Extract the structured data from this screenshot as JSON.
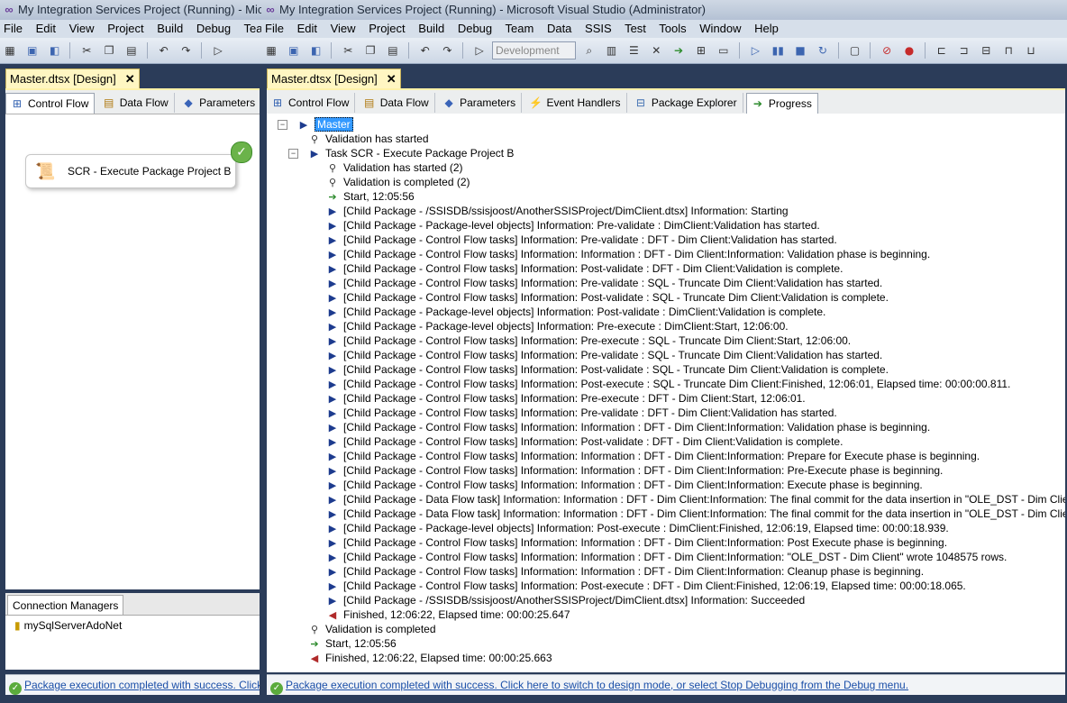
{
  "app": {
    "title_left": "My Integration Services Project (Running) - Microso",
    "title_right": "My Integration Services Project (Running) - Microsoft Visual Studio (Administrator)",
    "menu_left": [
      "File",
      "Edit",
      "View",
      "Project",
      "Build",
      "Debug",
      "Team"
    ],
    "menu_right": [
      "File",
      "Edit",
      "View",
      "Project",
      "Build",
      "Debug",
      "Team",
      "Data",
      "SSIS",
      "Test",
      "Tools",
      "Window",
      "Help"
    ],
    "config_combo": "Development"
  },
  "document": {
    "tab_title": "Master.dtsx [Design]",
    "close_glyph": "✕"
  },
  "designer_tabs_left": [
    "Control Flow",
    "Data Flow",
    "Parameters"
  ],
  "designer_tabs_right": [
    "Control Flow",
    "Data Flow",
    "Parameters",
    "Event Handlers",
    "Package Explorer",
    "Progress"
  ],
  "control_flow": {
    "task_label": "SCR - Execute Package Project B"
  },
  "connection_managers": {
    "tab_label": "Connection Managers",
    "items": [
      "mySqlServerAdoNet"
    ]
  },
  "status": {
    "left_text": "Package execution completed with success. Click here",
    "right_text": "Package execution completed with success. Click here to switch to design mode, or select Stop Debugging from the Debug menu."
  },
  "progress": {
    "rows": [
      {
        "indent": 0,
        "expander": "−",
        "icon": "play",
        "text": "Master",
        "selected": true
      },
      {
        "indent": 1,
        "icon": "valid",
        "text": "Validation has started"
      },
      {
        "indent": 1,
        "expander": "−",
        "icon": "play",
        "text": "Task SCR - Execute Package Project B"
      },
      {
        "indent": 2,
        "icon": "valid",
        "text": "Validation has started (2)"
      },
      {
        "indent": 2,
        "icon": "valid",
        "text": "Validation is completed (2)"
      },
      {
        "indent": 2,
        "icon": "start",
        "text": "Start, 12:05:56"
      },
      {
        "indent": 2,
        "icon": "play",
        "text": "[Child Package - /SSISDB/ssisjoost/AnotherSSISProject/DimClient.dtsx] Information: Starting"
      },
      {
        "indent": 2,
        "icon": "play",
        "text": "[Child Package - Package-level objects] Information: Pre-validate : DimClient:Validation has started."
      },
      {
        "indent": 2,
        "icon": "play",
        "text": "[Child Package - Control Flow tasks] Information: Pre-validate : DFT - Dim Client:Validation has started."
      },
      {
        "indent": 2,
        "icon": "play",
        "text": "[Child Package - Control Flow tasks] Information: Information : DFT - Dim Client:Information: Validation phase is beginning."
      },
      {
        "indent": 2,
        "icon": "play",
        "text": "[Child Package - Control Flow tasks] Information: Post-validate : DFT - Dim Client:Validation is complete."
      },
      {
        "indent": 2,
        "icon": "play",
        "text": "[Child Package - Control Flow tasks] Information: Pre-validate : SQL - Truncate Dim Client:Validation has started."
      },
      {
        "indent": 2,
        "icon": "play",
        "text": "[Child Package - Control Flow tasks] Information: Post-validate : SQL - Truncate Dim Client:Validation is complete."
      },
      {
        "indent": 2,
        "icon": "play",
        "text": "[Child Package - Package-level objects] Information: Post-validate : DimClient:Validation is complete."
      },
      {
        "indent": 2,
        "icon": "play",
        "text": "[Child Package - Package-level objects] Information: Pre-execute : DimClient:Start, 12:06:00."
      },
      {
        "indent": 2,
        "icon": "play",
        "text": "[Child Package - Control Flow tasks] Information: Pre-execute : SQL - Truncate Dim Client:Start, 12:06:00."
      },
      {
        "indent": 2,
        "icon": "play",
        "text": "[Child Package - Control Flow tasks] Information: Pre-validate : SQL - Truncate Dim Client:Validation has started."
      },
      {
        "indent": 2,
        "icon": "play",
        "text": "[Child Package - Control Flow tasks] Information: Post-validate : SQL - Truncate Dim Client:Validation is complete."
      },
      {
        "indent": 2,
        "icon": "play",
        "text": "[Child Package - Control Flow tasks] Information: Post-execute : SQL - Truncate Dim Client:Finished, 12:06:01, Elapsed time: 00:00:00.811."
      },
      {
        "indent": 2,
        "icon": "play",
        "text": "[Child Package - Control Flow tasks] Information: Pre-execute : DFT - Dim Client:Start, 12:06:01."
      },
      {
        "indent": 2,
        "icon": "play",
        "text": "[Child Package - Control Flow tasks] Information: Pre-validate : DFT - Dim Client:Validation has started."
      },
      {
        "indent": 2,
        "icon": "play",
        "text": "[Child Package - Control Flow tasks] Information: Information : DFT - Dim Client:Information: Validation phase is beginning."
      },
      {
        "indent": 2,
        "icon": "play",
        "text": "[Child Package - Control Flow tasks] Information: Post-validate : DFT - Dim Client:Validation is complete."
      },
      {
        "indent": 2,
        "icon": "play",
        "text": "[Child Package - Control Flow tasks] Information: Information : DFT - Dim Client:Information: Prepare for Execute phase is beginning."
      },
      {
        "indent": 2,
        "icon": "play",
        "text": "[Child Package - Control Flow tasks] Information: Information : DFT - Dim Client:Information: Pre-Execute phase is beginning."
      },
      {
        "indent": 2,
        "icon": "play",
        "text": "[Child Package - Control Flow tasks] Information: Information : DFT - Dim Client:Information: Execute phase is beginning."
      },
      {
        "indent": 2,
        "icon": "play",
        "text": "[Child Package - Data Flow task] Information: Information : DFT - Dim Client:Information: The final commit for the data insertion in \"OLE_DST - Dim Client\" has started."
      },
      {
        "indent": 2,
        "icon": "play",
        "text": "[Child Package - Data Flow task] Information: Information : DFT - Dim Client:Information: The final commit for the data insertion  in \"OLE_DST - Dim Client\" has ended."
      },
      {
        "indent": 2,
        "icon": "play",
        "text": "[Child Package - Package-level objects] Information: Post-execute : DimClient:Finished, 12:06:19, Elapsed time: 00:00:18.939."
      },
      {
        "indent": 2,
        "icon": "play",
        "text": "[Child Package - Control Flow tasks] Information: Information : DFT - Dim Client:Information: Post Execute phase is beginning."
      },
      {
        "indent": 2,
        "icon": "play",
        "text": "[Child Package - Control Flow tasks] Information: Information : DFT - Dim Client:Information: \"OLE_DST - Dim Client\" wrote 1048575 rows."
      },
      {
        "indent": 2,
        "icon": "play",
        "text": "[Child Package - Control Flow tasks] Information: Information : DFT - Dim Client:Information: Cleanup phase is beginning."
      },
      {
        "indent": 2,
        "icon": "play",
        "text": "[Child Package - Control Flow tasks] Information: Post-execute : DFT - Dim Client:Finished, 12:06:19, Elapsed time: 00:00:18.065."
      },
      {
        "indent": 2,
        "icon": "play",
        "text": "[Child Package - /SSISDB/ssisjoost/AnotherSSISProject/DimClient.dtsx] Information: Succeeded"
      },
      {
        "indent": 2,
        "icon": "fin",
        "text": "Finished, 12:06:22, Elapsed time: 00:00:25.647"
      },
      {
        "indent": 1,
        "icon": "valid",
        "text": "Validation is completed"
      },
      {
        "indent": 1,
        "icon": "start",
        "text": "Start, 12:05:56"
      },
      {
        "indent": 1,
        "icon": "fin",
        "text": "Finished, 12:06:22, Elapsed time: 00:00:25.663"
      }
    ]
  },
  "icons": {
    "play": "▶",
    "start": "➔",
    "fin": "◀",
    "valid": "⚲",
    "check": "✓"
  }
}
